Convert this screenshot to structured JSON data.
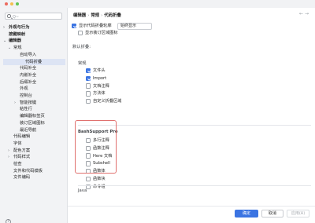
{
  "window": {
    "traffic_lights": [
      "#ec6a5e",
      "#f4bf4f",
      "#61c554"
    ]
  },
  "sidebar": {
    "search_placeholder": "Q~",
    "items": [
      {
        "label": "外观与行为",
        "level": 0,
        "chevron": "›",
        "bold": true
      },
      {
        "label": "按键映射",
        "level": 0,
        "chevron": "",
        "bold": true
      },
      {
        "label": "编辑器",
        "level": 0,
        "chevron": "⌄",
        "bold": true
      },
      {
        "label": "常规",
        "level": 1,
        "chevron": "⌄",
        "bold": false
      },
      {
        "label": "自动导入",
        "level": 2,
        "chevron": "",
        "bold": false
      },
      {
        "label": "代码折叠",
        "level": 2,
        "chevron": "",
        "bold": false,
        "selected": true
      },
      {
        "label": "代码补全",
        "level": 2,
        "chevron": "",
        "bold": false
      },
      {
        "label": "内嵌补全",
        "level": 2,
        "chevron": "",
        "bold": false
      },
      {
        "label": "后缀补全",
        "level": 2,
        "chevron": "",
        "bold": false
      },
      {
        "label": "外观",
        "level": 2,
        "chevron": "",
        "bold": false
      },
      {
        "label": "控制台",
        "level": 2,
        "chevron": "",
        "bold": false
      },
      {
        "label": "智能按键",
        "level": 2,
        "chevron": "›",
        "bold": false
      },
      {
        "label": "粘性行",
        "level": 2,
        "chevron": "",
        "bold": false
      },
      {
        "label": "编辑器标签页",
        "level": 2,
        "chevron": "",
        "bold": false
      },
      {
        "label": "装订区域图标",
        "level": 2,
        "chevron": "",
        "bold": false
      },
      {
        "label": "最近导航",
        "level": 2,
        "chevron": "",
        "bold": false
      },
      {
        "label": "代码编辑",
        "level": 1,
        "chevron": "",
        "bold": false
      },
      {
        "label": "字体",
        "level": 1,
        "chevron": "",
        "bold": false
      },
      {
        "label": "配色方案",
        "level": 1,
        "chevron": "›",
        "bold": false
      },
      {
        "label": "代码样式",
        "level": 1,
        "chevron": "›",
        "bold": false
      },
      {
        "label": "检查",
        "level": 1,
        "chevron": "",
        "bold": false,
        "mini": "⊟"
      },
      {
        "label": "文件和代码模板",
        "level": 1,
        "chevron": "",
        "bold": false,
        "mini": "⊟"
      },
      {
        "label": "文件编码",
        "level": 1,
        "chevron": "",
        "bold": false,
        "mini": "⊟"
      }
    ],
    "help_label": "?"
  },
  "main": {
    "breadcrumb": [
      "编辑器",
      "常规",
      "代码折叠"
    ],
    "nav_arrows": "← →",
    "show_outline": {
      "label": "显示代码折叠轮廓",
      "checked": true,
      "value": "始终显示"
    },
    "show_gutter": {
      "label": "显示装订区域图标",
      "checked": false
    },
    "fold_default_title": "默认折叠:",
    "general": {
      "title": "常规",
      "items": [
        {
          "label": "文件头",
          "checked": true
        },
        {
          "label": "Import",
          "checked": true
        },
        {
          "label": "文档注释",
          "checked": false
        },
        {
          "label": "方法体",
          "checked": false
        },
        {
          "label": "自定义折叠区域",
          "checked": false
        }
      ]
    },
    "bash": {
      "title": "BashSupport Pro",
      "items": [
        {
          "label": "多行注释",
          "checked": false
        },
        {
          "label": "函数注释",
          "checked": false
        },
        {
          "label": "Here 文档",
          "checked": false
        },
        {
          "label": "Subshell",
          "checked": false
        },
        {
          "label": "函数体",
          "checked": false
        },
        {
          "label": "函数块",
          "checked": false
        },
        {
          "label": "命令组",
          "checked": false
        }
      ]
    },
    "java_title": "Java"
  },
  "footer": {
    "ok": "确定",
    "cancel": "取消",
    "apply": "应用(A)"
  },
  "colors": {
    "accent": "#3b74e2",
    "highlight_border": "#e0706e",
    "selection": "#dde4f4"
  }
}
